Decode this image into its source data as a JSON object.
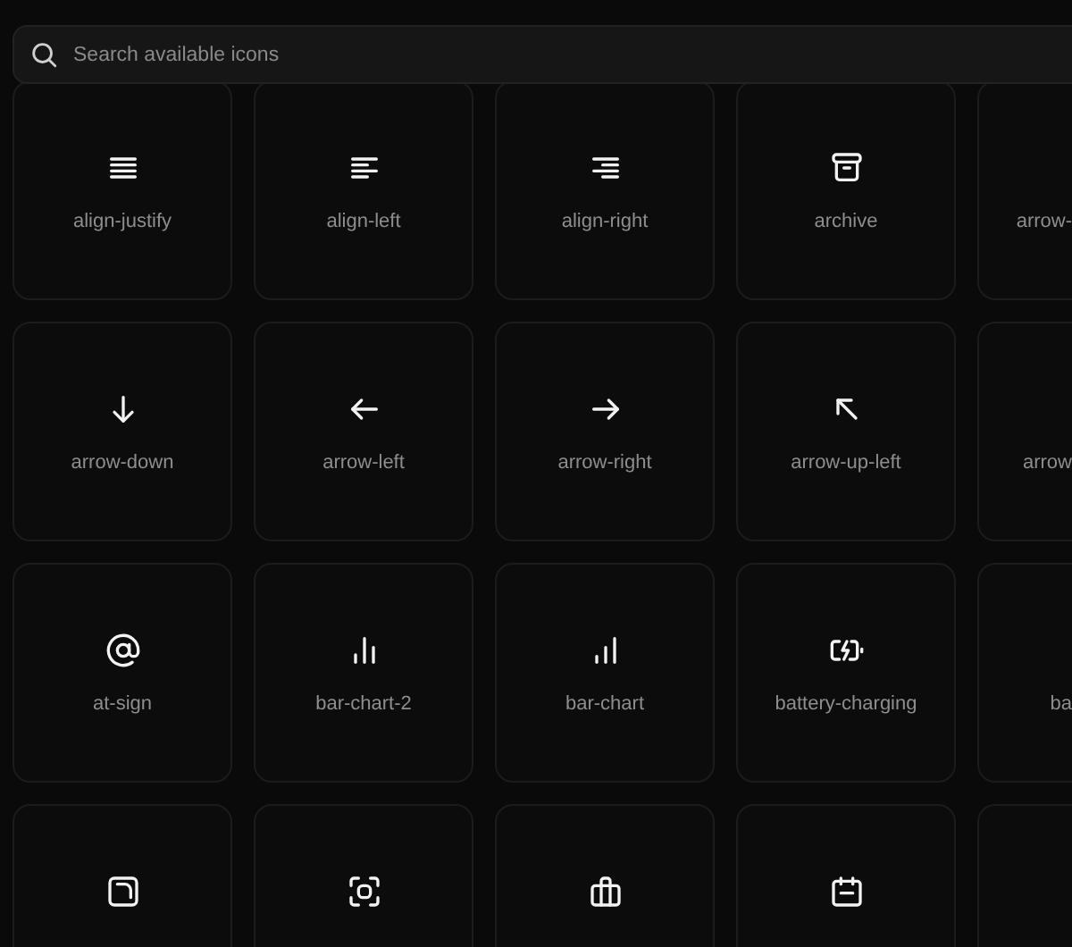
{
  "search": {
    "placeholder": "Search available icons"
  },
  "rows": [
    {
      "cards": [
        {
          "label": "align-justify"
        },
        {
          "label": "align-left"
        },
        {
          "label": "align-right"
        },
        {
          "label": "archive"
        }
      ],
      "edge_label": "arrow-"
    },
    {
      "cards": [
        {
          "label": "arrow-down"
        },
        {
          "label": "arrow-left"
        },
        {
          "label": "arrow-right"
        },
        {
          "label": "arrow-up-left"
        }
      ],
      "edge_label": "arrow"
    },
    {
      "cards": [
        {
          "label": "at-sign"
        },
        {
          "label": "bar-chart-2"
        },
        {
          "label": "bar-chart"
        },
        {
          "label": "battery-charging"
        }
      ],
      "edge_label": "ba"
    }
  ],
  "clipped_row": true
}
